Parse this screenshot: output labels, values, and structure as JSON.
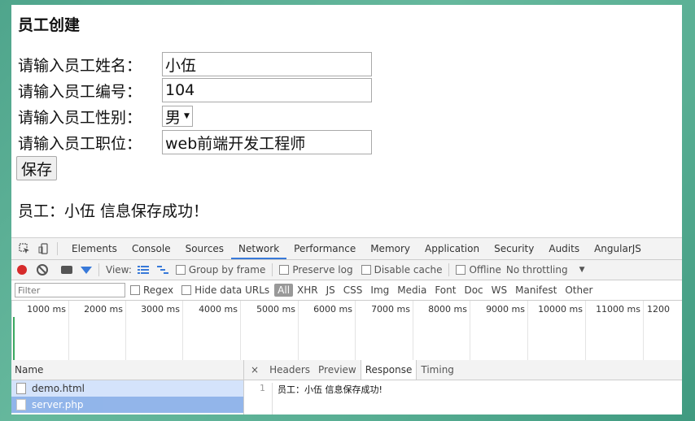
{
  "form": {
    "title": "员工创建",
    "name_label": "请输入员工姓名：",
    "name_value": "小伍",
    "number_label": "请输入员工编号：",
    "number_value": "104",
    "gender_label": "请输入员工性别：",
    "gender_value": "男",
    "position_label": "请输入员工职位：",
    "position_value": "web前端开发工程师",
    "save_label": "保存",
    "result": "员工：小伍 信息保存成功！"
  },
  "devtools": {
    "tabs": [
      "Elements",
      "Console",
      "Sources",
      "Network",
      "Performance",
      "Memory",
      "Application",
      "Security",
      "Audits",
      "AngularJS"
    ],
    "active_tab": "Network",
    "toolbar": {
      "view_label": "View:",
      "group_by_frame": "Group by frame",
      "preserve_log": "Preserve log",
      "disable_cache": "Disable cache",
      "offline": "Offline",
      "throttling": "No throttling"
    },
    "filter": {
      "placeholder": "Filter",
      "regex": "Regex",
      "hide_data_urls": "Hide data URLs",
      "types": [
        "All",
        "XHR",
        "JS",
        "CSS",
        "Img",
        "Media",
        "Font",
        "Doc",
        "WS",
        "Manifest",
        "Other"
      ]
    },
    "timeline_ticks": [
      "1000 ms",
      "2000 ms",
      "3000 ms",
      "4000 ms",
      "5000 ms",
      "6000 ms",
      "7000 ms",
      "8000 ms",
      "9000 ms",
      "10000 ms",
      "11000 ms",
      "1200"
    ],
    "name_header": "Name",
    "requests": [
      "demo.html",
      "server.php"
    ],
    "detail_close": "×",
    "detail_tabs": [
      "Headers",
      "Preview",
      "Response",
      "Timing"
    ],
    "active_detail_tab": "Response",
    "response_line_number": "1",
    "response_text": "员工：小伍 信息保存成功!"
  },
  "colors": {
    "accent": "#3879d9",
    "record": "#d62b2b",
    "frame_background": "#58ae93"
  }
}
